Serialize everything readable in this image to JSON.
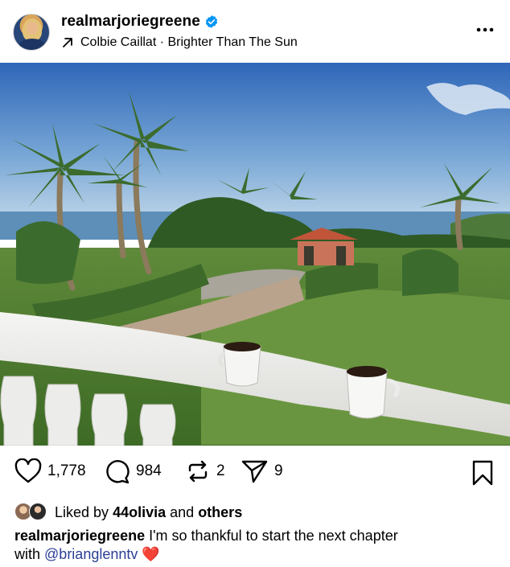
{
  "header": {
    "username": "realmarjoriegreene",
    "audio": "Colbie Caillat · Brighter Than The Sun"
  },
  "photo": {
    "description_icon": "mute-icon"
  },
  "actions": {
    "likes_count": "1,778",
    "comments_count": "984",
    "reposts_count": "2",
    "shares_count": "9"
  },
  "liked_by": {
    "prefix": "Liked by",
    "user": "44olivia",
    "and": "and",
    "others": "others"
  },
  "caption": {
    "username": "realmarjoriegreene",
    "text_part1": "I'm so thankful to start the next chapter",
    "text_part2": "with",
    "mention": "@brianglenntv",
    "emoji": "❤️"
  },
  "colors": {
    "verified": "#0095f6",
    "mention": "#2b3f96",
    "heart_emoji": "#e0242f"
  }
}
